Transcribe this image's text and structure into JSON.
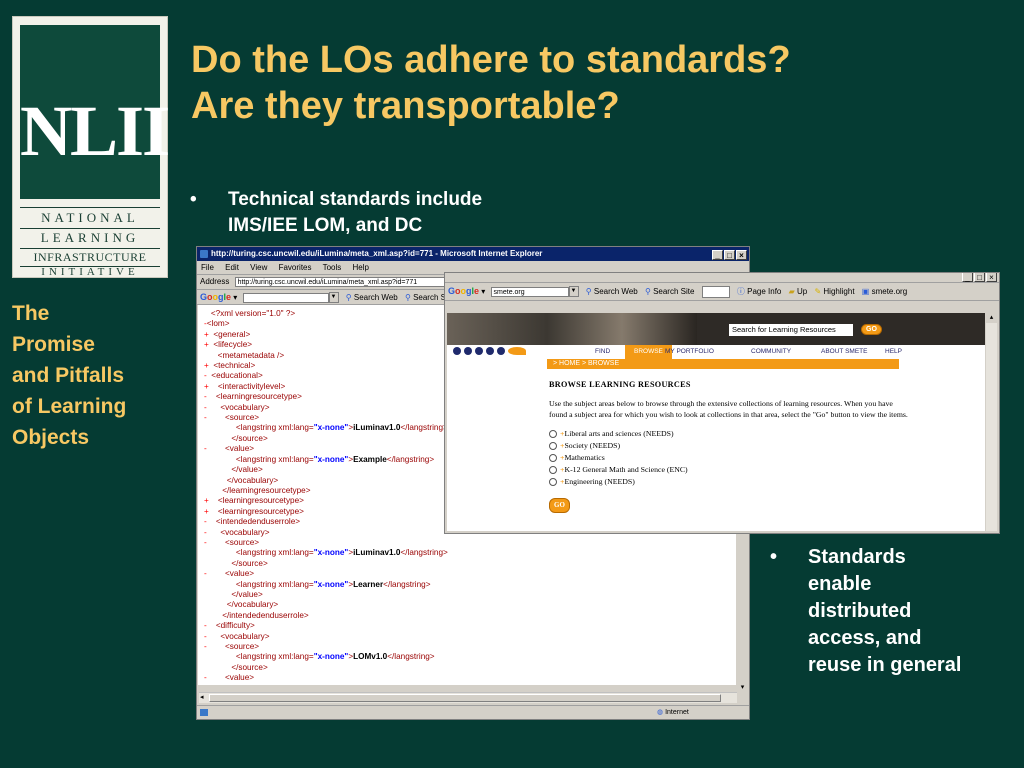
{
  "logo": {
    "big": "NLII",
    "lines": [
      "NATIONAL",
      "LEARNING",
      "INFRASTRUCTURE",
      "INITIATIVE"
    ]
  },
  "side_caption": [
    "The",
    "Promise",
    "and Pitfalls",
    "of Learning",
    "Objects"
  ],
  "title": [
    "Do the LOs adhere to standards?",
    "Are they transportable?"
  ],
  "bullets": [
    {
      "mark": "•",
      "lines": [
        "Technical standards include",
        "IMS/IEE LOM, and DC"
      ]
    },
    {
      "mark": "•",
      "lines": [
        "Standards",
        "enable",
        "distributed",
        "access, and",
        "reuse in general"
      ]
    }
  ],
  "ie_window": {
    "title": "http://turing.csc.uncwil.edu/iLumina/meta_xml.asp?id=771 - Microsoft Internet Explorer",
    "menu": [
      "File",
      "Edit",
      "View",
      "Favorites",
      "Tools",
      "Help"
    ],
    "address_label": "Address",
    "address": "http://turing.csc.uncwil.edu/iLumina/meta_xml.asp?id=771",
    "google_label": "Google",
    "toolbar": [
      "Search Web",
      "Search Site"
    ],
    "status": "Internet",
    "xml_lines": [
      {
        "pm": "",
        "indent": "  ",
        "tag": "<?xml version=\"1.0\" ?>"
      },
      {
        "pm": "-",
        "indent": "",
        "tag": "<lom>"
      },
      {
        "pm": "+",
        "indent": "  ",
        "tag": "<general>"
      },
      {
        "pm": "+",
        "indent": "  ",
        "tag": "<lifecycle>"
      },
      {
        "pm": "",
        "indent": "     ",
        "tag": "<metametadata />"
      },
      {
        "pm": "+",
        "indent": "  ",
        "tag": "<technical>"
      },
      {
        "pm": "-",
        "indent": "  ",
        "tag": "<educational>"
      },
      {
        "pm": "+",
        "indent": "    ",
        "tag": "<interactivitylevel>"
      },
      {
        "pm": "-",
        "indent": "    ",
        "tag": "<learningresourcetype>"
      },
      {
        "pm": "-",
        "indent": "      ",
        "tag": "<vocabulary>"
      },
      {
        "pm": "-",
        "indent": "        ",
        "tag": "<source>"
      },
      {
        "pm": "",
        "indent": "             ",
        "tag": "<langstring ",
        "attr": "xml:lang=",
        "val": "\"x-none\"",
        "close": ">",
        "text": "iLuminav1.0",
        "end": "</langstring>"
      },
      {
        "pm": "",
        "indent": "           ",
        "tag": "</source>"
      },
      {
        "pm": "-",
        "indent": "        ",
        "tag": "<value>"
      },
      {
        "pm": "",
        "indent": "             ",
        "tag": "<langstring ",
        "attr": "xml:lang=",
        "val": "\"x-none\"",
        "close": ">",
        "text": "Example",
        "end": "</langstring>"
      },
      {
        "pm": "",
        "indent": "           ",
        "tag": "</value>"
      },
      {
        "pm": "",
        "indent": "         ",
        "tag": "</vocabulary>"
      },
      {
        "pm": "",
        "indent": "       ",
        "tag": "</learningresourcetype>"
      },
      {
        "pm": "+",
        "indent": "    ",
        "tag": "<learningresourcetype>"
      },
      {
        "pm": "+",
        "indent": "    ",
        "tag": "<learningresourcetype>"
      },
      {
        "pm": "-",
        "indent": "    ",
        "tag": "<intendedenduserrole>"
      },
      {
        "pm": "-",
        "indent": "      ",
        "tag": "<vocabulary>"
      },
      {
        "pm": "-",
        "indent": "        ",
        "tag": "<source>"
      },
      {
        "pm": "",
        "indent": "             ",
        "tag": "<langstring ",
        "attr": "xml:lang=",
        "val": "\"x-none\"",
        "close": ">",
        "text": "iLuminav1.0",
        "end": "</langstring>"
      },
      {
        "pm": "",
        "indent": "           ",
        "tag": "</source>"
      },
      {
        "pm": "-",
        "indent": "        ",
        "tag": "<value>"
      },
      {
        "pm": "",
        "indent": "             ",
        "tag": "<langstring ",
        "attr": "xml:lang=",
        "val": "\"x-none\"",
        "close": ">",
        "text": "Learner",
        "end": "</langstring>"
      },
      {
        "pm": "",
        "indent": "           ",
        "tag": "</value>"
      },
      {
        "pm": "",
        "indent": "         ",
        "tag": "</vocabulary>"
      },
      {
        "pm": "",
        "indent": "       ",
        "tag": "</intendedenduserrole>"
      },
      {
        "pm": "-",
        "indent": "    ",
        "tag": "<difficulty>"
      },
      {
        "pm": "-",
        "indent": "      ",
        "tag": "<vocabulary>"
      },
      {
        "pm": "-",
        "indent": "        ",
        "tag": "<source>"
      },
      {
        "pm": "",
        "indent": "             ",
        "tag": "<langstring ",
        "attr": "xml:lang=",
        "val": "\"x-none\"",
        "close": ">",
        "text": "LOMv1.0",
        "end": "</langstring>"
      },
      {
        "pm": "",
        "indent": "           ",
        "tag": "</source>"
      },
      {
        "pm": "-",
        "indent": "        ",
        "tag": "<value>"
      }
    ]
  },
  "smete_window": {
    "google_label": "Google",
    "address": "smete.org",
    "toolbar": [
      "Search Web",
      "Search Site",
      "Page Info",
      "Up",
      "Highlight",
      "smete.org"
    ],
    "search_box": "Search for Learning Resources",
    "go": "GO",
    "nav": [
      "FIND",
      "BROWSE",
      "MY PORTFOLIO",
      "COMMUNITY",
      "ABOUT SMETE",
      "HELP"
    ],
    "breadcrumb": "> HOME > BROWSE",
    "heading": "BROWSE LEARNING RESOURCES",
    "intro": "Use the subject areas below to browse through the extensive collections of learning resources. When you have found a subject area for which you wish to look at collections in that area, select the \"Go\" button to view the items.",
    "options": [
      "Liberal arts and sciences (NEEDS)",
      "Society (NEEDS)",
      "Mathematics",
      "K-12 General Math and Science (ENC)",
      "Engineering (NEEDS)"
    ],
    "go_bottom": "GO"
  }
}
